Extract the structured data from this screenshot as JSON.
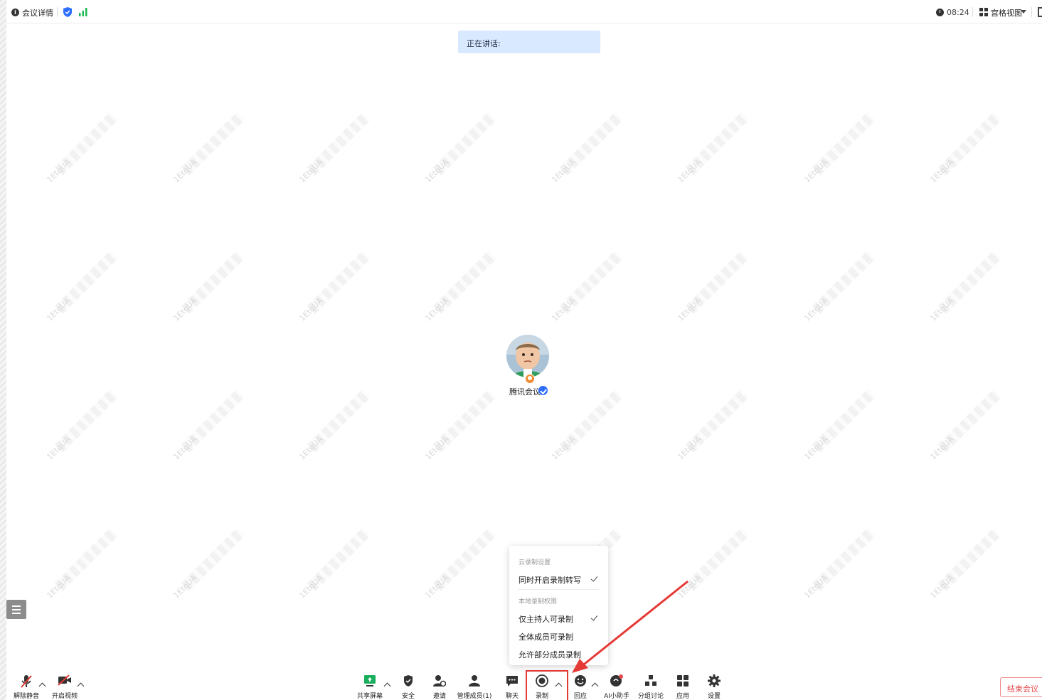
{
  "topbar": {
    "meeting_details": "会议详情",
    "time": "08:24",
    "view_mode": "宫格视图"
  },
  "speaking": {
    "label": "正在讲话:"
  },
  "participant": {
    "name": "腾讯会议"
  },
  "watermark": {
    "text": "1EtqUA"
  },
  "record_menu": {
    "cloud_heading": "云录制设置",
    "cloud_items": [
      {
        "label": "同时开启录制转写",
        "checked": true
      }
    ],
    "local_heading": "本地录制权限",
    "local_items": [
      {
        "label": "仅主持人可录制",
        "checked": true
      },
      {
        "label": "全体成员可录制",
        "checked": false
      },
      {
        "label": "允许部分成员录制",
        "checked": false
      }
    ]
  },
  "toolbar": {
    "unmute": "解除静音",
    "start_video": "开启视频",
    "share_screen": "共享屏幕",
    "security": "安全",
    "invite": "邀请",
    "manage_members": "管理成员(1)",
    "chat": "聊天",
    "record": "录制",
    "react": "回应",
    "ai_assistant": "AI小助手",
    "breakout": "分组讨论",
    "apps": "应用",
    "settings": "设置",
    "end_meeting": "结束会议"
  },
  "colors": {
    "accent_blue": "#2f6fff",
    "speaking_bg": "#d9e9ff",
    "share_green": "#1aaf5d",
    "signal_green": "#1db954",
    "highlight_red": "#e53935",
    "end_red": "#e5484d"
  }
}
